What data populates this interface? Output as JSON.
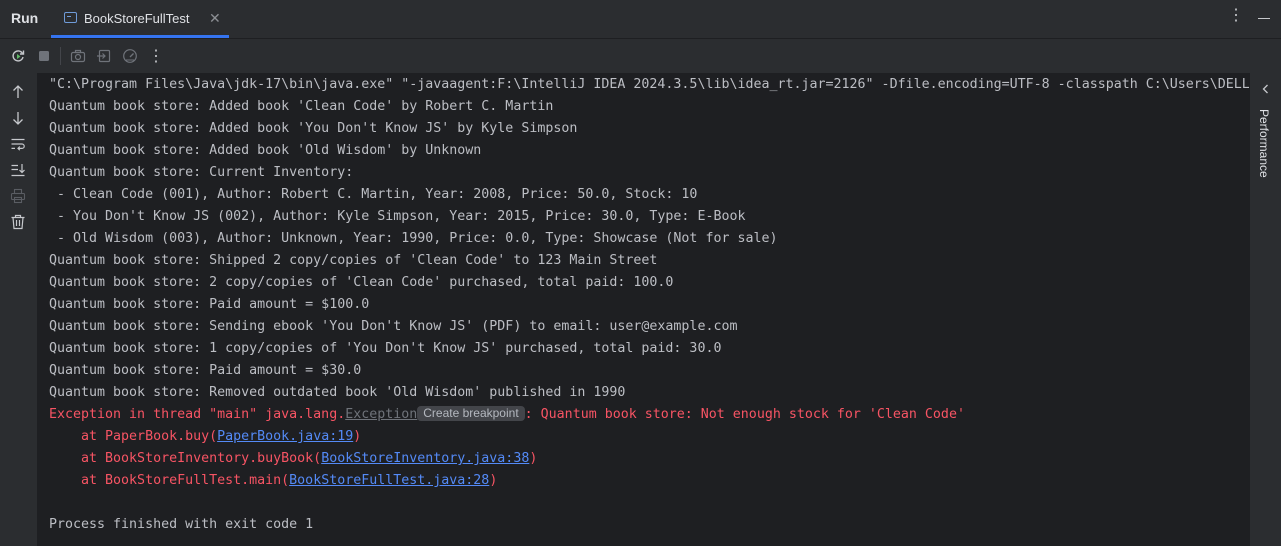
{
  "header": {
    "run_title": "Run",
    "tab_label": "BookStoreFullTest"
  },
  "sidebar": {
    "performance_label": "Performance"
  },
  "console": {
    "lines": [
      "\"C:\\Program Files\\Java\\jdk-17\\bin\\java.exe\" \"-javaagent:F:\\IntelliJ IDEA 2024.3.5\\lib\\idea_rt.jar=2126\" -Dfile.encoding=UTF-8 -classpath C:\\Users\\DELL",
      "Quantum book store: Added book 'Clean Code' by Robert C. Martin",
      "Quantum book store: Added book 'You Don't Know JS' by Kyle Simpson",
      "Quantum book store: Added book 'Old Wisdom' by Unknown",
      "Quantum book store: Current Inventory:",
      " - Clean Code (001), Author: Robert C. Martin, Year: 2008, Price: 50.0, Stock: 10",
      " - You Don't Know JS (002), Author: Kyle Simpson, Year: 2015, Price: 30.0, Type: E-Book",
      " - Old Wisdom (003), Author: Unknown, Year: 1990, Price: 0.0, Type: Showcase (Not for sale)",
      "Quantum book store: Shipped 2 copy/copies of 'Clean Code' to 123 Main Street",
      "Quantum book store: 2 copy/copies of 'Clean Code' purchased, total paid: 100.0",
      "Quantum book store: Paid amount = $100.0",
      "Quantum book store: Sending ebook 'You Don't Know JS' (PDF) to email: user@example.com",
      "Quantum book store: 1 copy/copies of 'You Don't Know JS' purchased, total paid: 30.0",
      "Quantum book store: Paid amount = $30.0",
      "Quantum book store: Removed outdated book 'Old Wisdom' published in 1990"
    ],
    "exception": {
      "prefix": "Exception in thread \"main\" java.lang.",
      "name": "Exception",
      "breakpoint_badge": "Create breakpoint",
      "message": ": Quantum book store: Not enough stock for 'Clean Code'"
    },
    "stack": [
      {
        "prefix": "    at PaperBook.buy(",
        "link": "PaperBook.java:19",
        "suffix": ")"
      },
      {
        "prefix": "    at BookStoreInventory.buyBook(",
        "link": "BookStoreInventory.java:38",
        "suffix": ")"
      },
      {
        "prefix": "    at BookStoreFullTest.main(",
        "link": "BookStoreFullTest.java:28",
        "suffix": ")"
      }
    ],
    "exit_line": "Process finished with exit code 1"
  },
  "icons": {
    "toolbar": [
      "rerun-icon",
      "stop-icon",
      "camera-icon",
      "exit-icon",
      "gauge-icon",
      "more-vertical-icon"
    ],
    "gutter": [
      "arrow-up-icon",
      "arrow-down-icon",
      "soft-wrap-icon",
      "scroll-to-end-icon",
      "print-icon",
      "trash-icon"
    ]
  },
  "colors": {
    "background": "#1e1f22",
    "panel": "#2b2d30",
    "text": "#bcbec4",
    "error": "#f75464",
    "link": "#548af7",
    "accent": "#3574f0"
  }
}
